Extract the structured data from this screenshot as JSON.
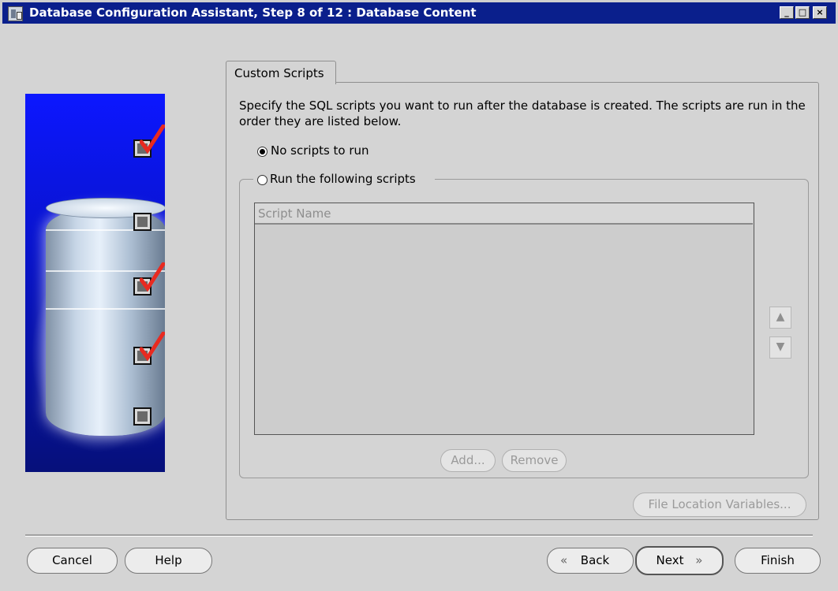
{
  "window": {
    "title": "Database Configuration Assistant, Step 8 of 12 : Database Content",
    "controls": {
      "minimize_label": "_",
      "maximize_label": "□",
      "close_label": "×"
    }
  },
  "side_panel": {
    "steps": [
      {
        "state": "checked"
      },
      {
        "state": "unchecked"
      },
      {
        "state": "checked"
      },
      {
        "state": "checked"
      },
      {
        "state": "unchecked"
      }
    ],
    "colors": {
      "background": "#0c17ff",
      "checkmark": "#e82a20"
    }
  },
  "tab": {
    "label": "Custom Scripts"
  },
  "content": {
    "description": "Specify the SQL scripts you want to run after the database is created. The scripts are run in the order they are listed below.",
    "options": {
      "no_scripts": {
        "label": "No scripts to run",
        "selected": true
      },
      "run_scripts": {
        "label": "Run the following scripts",
        "selected": false
      }
    },
    "scripts_table": {
      "columns": [
        "Script Name"
      ],
      "rows": []
    },
    "buttons": {
      "move_up_icon": "arrow-up",
      "move_down_icon": "arrow-down",
      "add_label": "Add...",
      "remove_label": "Remove",
      "file_location_label": "File Location Variables..."
    }
  },
  "footer": {
    "cancel_label": "Cancel",
    "help_label": "Help",
    "back_label": "Back",
    "next_label": "Next",
    "finish_label": "Finish",
    "back_icon": "double-chevron-left",
    "next_icon": "double-chevron-right"
  }
}
